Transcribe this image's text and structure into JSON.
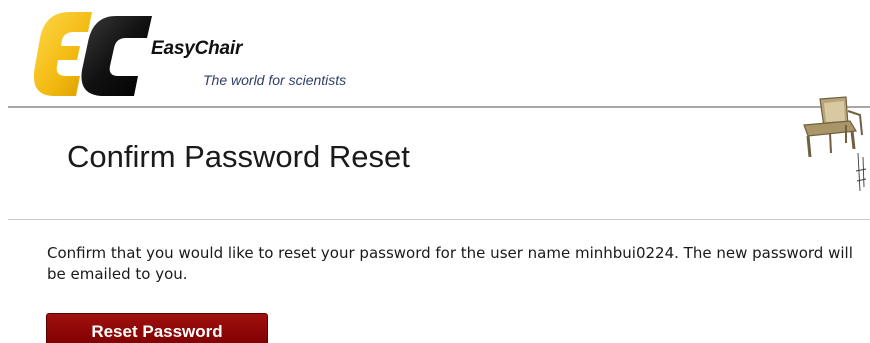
{
  "header": {
    "brand_name": "EasyChair",
    "tagline": "The world for scientists",
    "logo_icon": "easychair-ec-logo-icon",
    "chair_icon": "easychair-chair-illustration-icon",
    "colors": {
      "logo_yellow": "#F2B90F",
      "logo_black": "#111111",
      "tagline": "#2E3E67"
    }
  },
  "main": {
    "title": "Confirm Password Reset",
    "message": "Confirm that you would like to reset your password for the user name minhbui0224. The new password will be emailed to you.",
    "reset_button_label": "Reset Password",
    "colors": {
      "button": "#8B0000"
    }
  }
}
